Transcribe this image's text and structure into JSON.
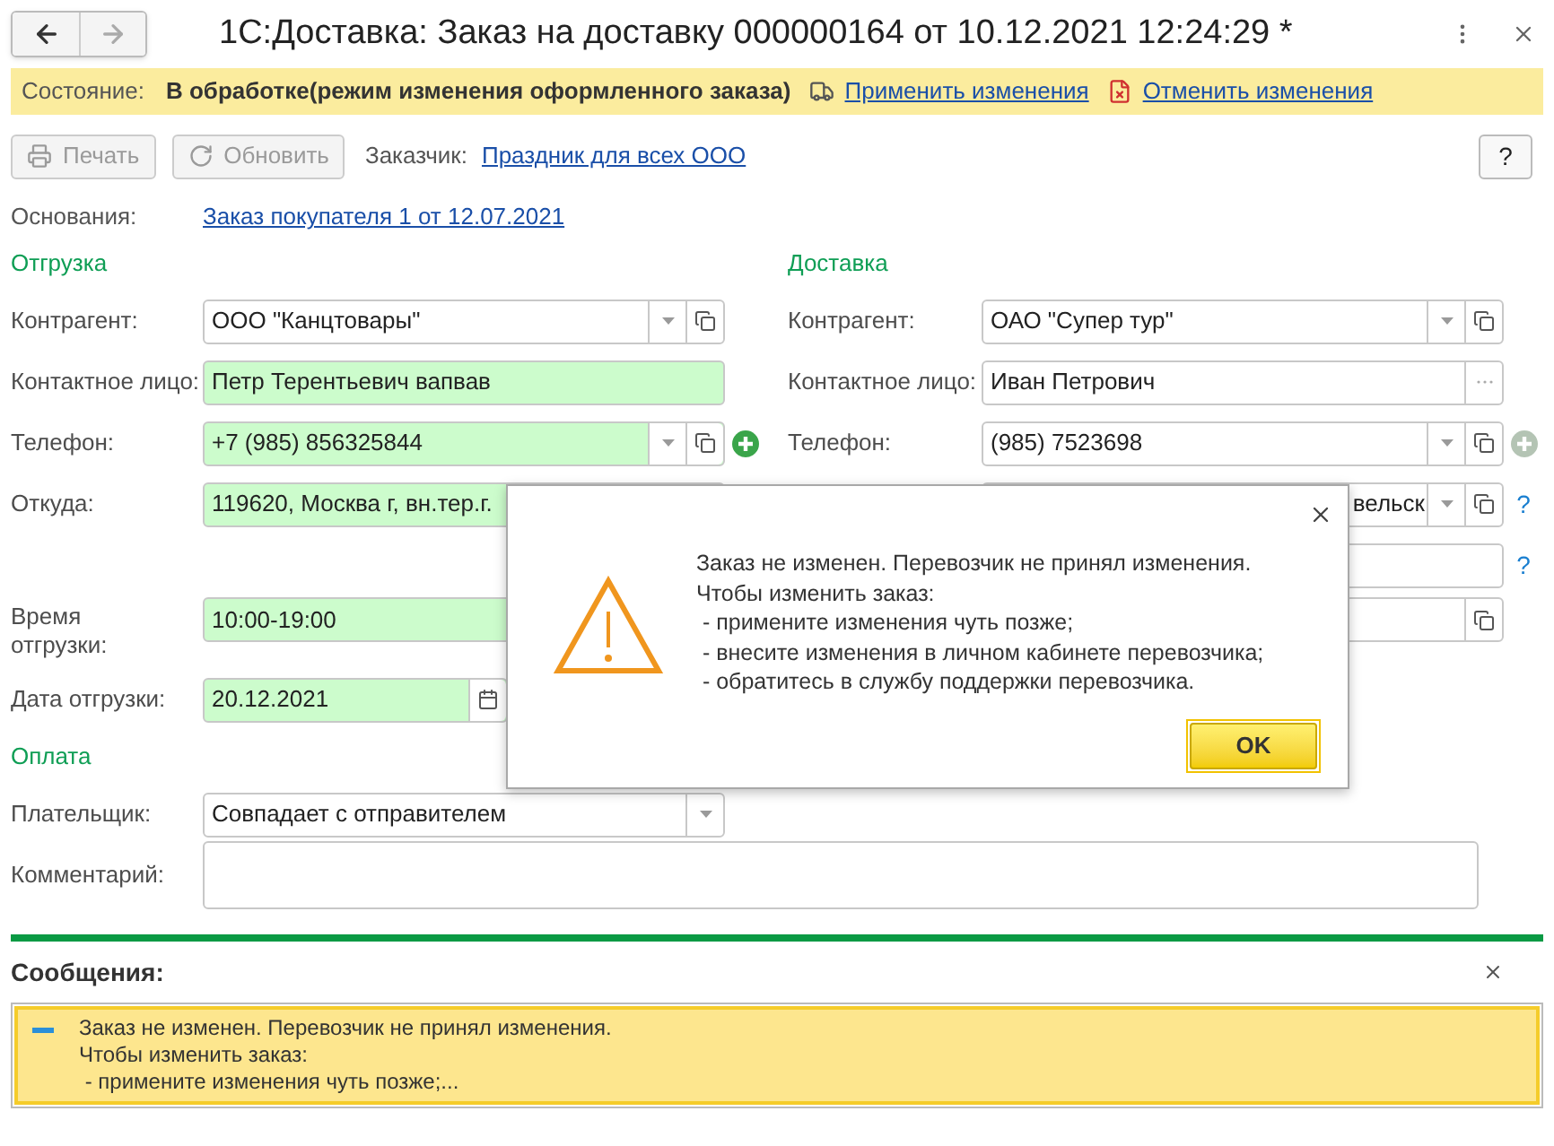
{
  "window": {
    "title": "1С:Доставка: Заказ на доставку 000000164 от 10.12.2021 12:24:29 *"
  },
  "nav_buttons": [
    {
      "kind": "back",
      "disabled": false
    },
    {
      "kind": "forward",
      "disabled": true
    }
  ],
  "status_bar": {
    "label": "Состояние:",
    "value": "В обработке(режим изменения оформленного заказа)",
    "actions": [
      {
        "kind": "apply",
        "label": "Применить изменения"
      },
      {
        "kind": "cancel",
        "label": "Отменить изменения"
      }
    ]
  },
  "toolbar": {
    "buttons": [
      {
        "kind": "print",
        "label": "Печать",
        "disabled": true
      },
      {
        "kind": "refresh",
        "label": "Обновить",
        "disabled": true
      }
    ],
    "customer_label": "Заказчик:",
    "customer_link": "Праздник для всех ООО",
    "help": "?"
  },
  "basis": {
    "label": "Основания:",
    "link": "Заказ покупателя 1 от 12.07.2021"
  },
  "shipment": {
    "heading": "Отгрузка",
    "fields": [
      {
        "label": "Контрагент:",
        "value": "ООО \"Канцтовары\"",
        "kind": "select",
        "filled": false
      },
      {
        "label": "Контактное лицо:",
        "value": "Петр Терентьевич вапвав",
        "kind": "input",
        "filled": true
      },
      {
        "label": "Телефон:",
        "value": "+7 (985) 856325844",
        "kind": "select",
        "filled": true,
        "add_button": {
          "disabled": false
        }
      },
      {
        "label": "Откуда:",
        "value": "119620, Москва г, вн.тер.г.",
        "kind": "input",
        "filled": true
      },
      {
        "label": "Время отгрузки:",
        "value": "10:00-19:00",
        "kind": "input",
        "filled": true,
        "tall": true
      },
      {
        "label": "Дата отгрузки:",
        "value": "20.12.2021",
        "kind": "date",
        "filled": true
      }
    ]
  },
  "delivery": {
    "heading": "Доставка",
    "fields": [
      {
        "label": "Контрагент:",
        "value": "ОАО \"Супер тур\"",
        "kind": "select",
        "filled": false
      },
      {
        "label": "Контактное лицо:",
        "value": "Иван Петрович",
        "kind": "choice",
        "filled": false
      },
      {
        "label": "Телефон:",
        "value": "(985) 7523698",
        "kind": "select",
        "filled": false,
        "add_button": {
          "disabled": true
        }
      },
      {
        "value": "вельск",
        "kind": "select",
        "filled": false,
        "clipped": true,
        "help": "?"
      },
      {
        "kind": "input",
        "filled": false,
        "help": "?"
      },
      {
        "kind": "open",
        "filled": false,
        "tall": true
      }
    ]
  },
  "payment": {
    "heading": "Оплата",
    "fields": [
      {
        "label": "Плательщик:",
        "value": "Совпадает с отправителем",
        "kind": "dropdown",
        "filled": false
      },
      {
        "label": "Комментарий:",
        "kind": "memo",
        "filled": false
      }
    ]
  },
  "dialog": {
    "lines": [
      "Заказ не изменен. Перевозчик не принял изменения.",
      "Чтобы изменить заказ:",
      " - примените изменения чуть позже;",
      " - внесите изменения в личном кабинете перевозчика;",
      " - обратитесь в службу поддержки перевозчика."
    ],
    "button": "OK"
  },
  "messages": {
    "title": "Сообщения:",
    "items": [
      {
        "lines": [
          "Заказ не изменен. Перевозчик не принял изменения.",
          "Чтобы изменить заказ:",
          " - примените изменения чуть позже;..."
        ]
      }
    ]
  }
}
